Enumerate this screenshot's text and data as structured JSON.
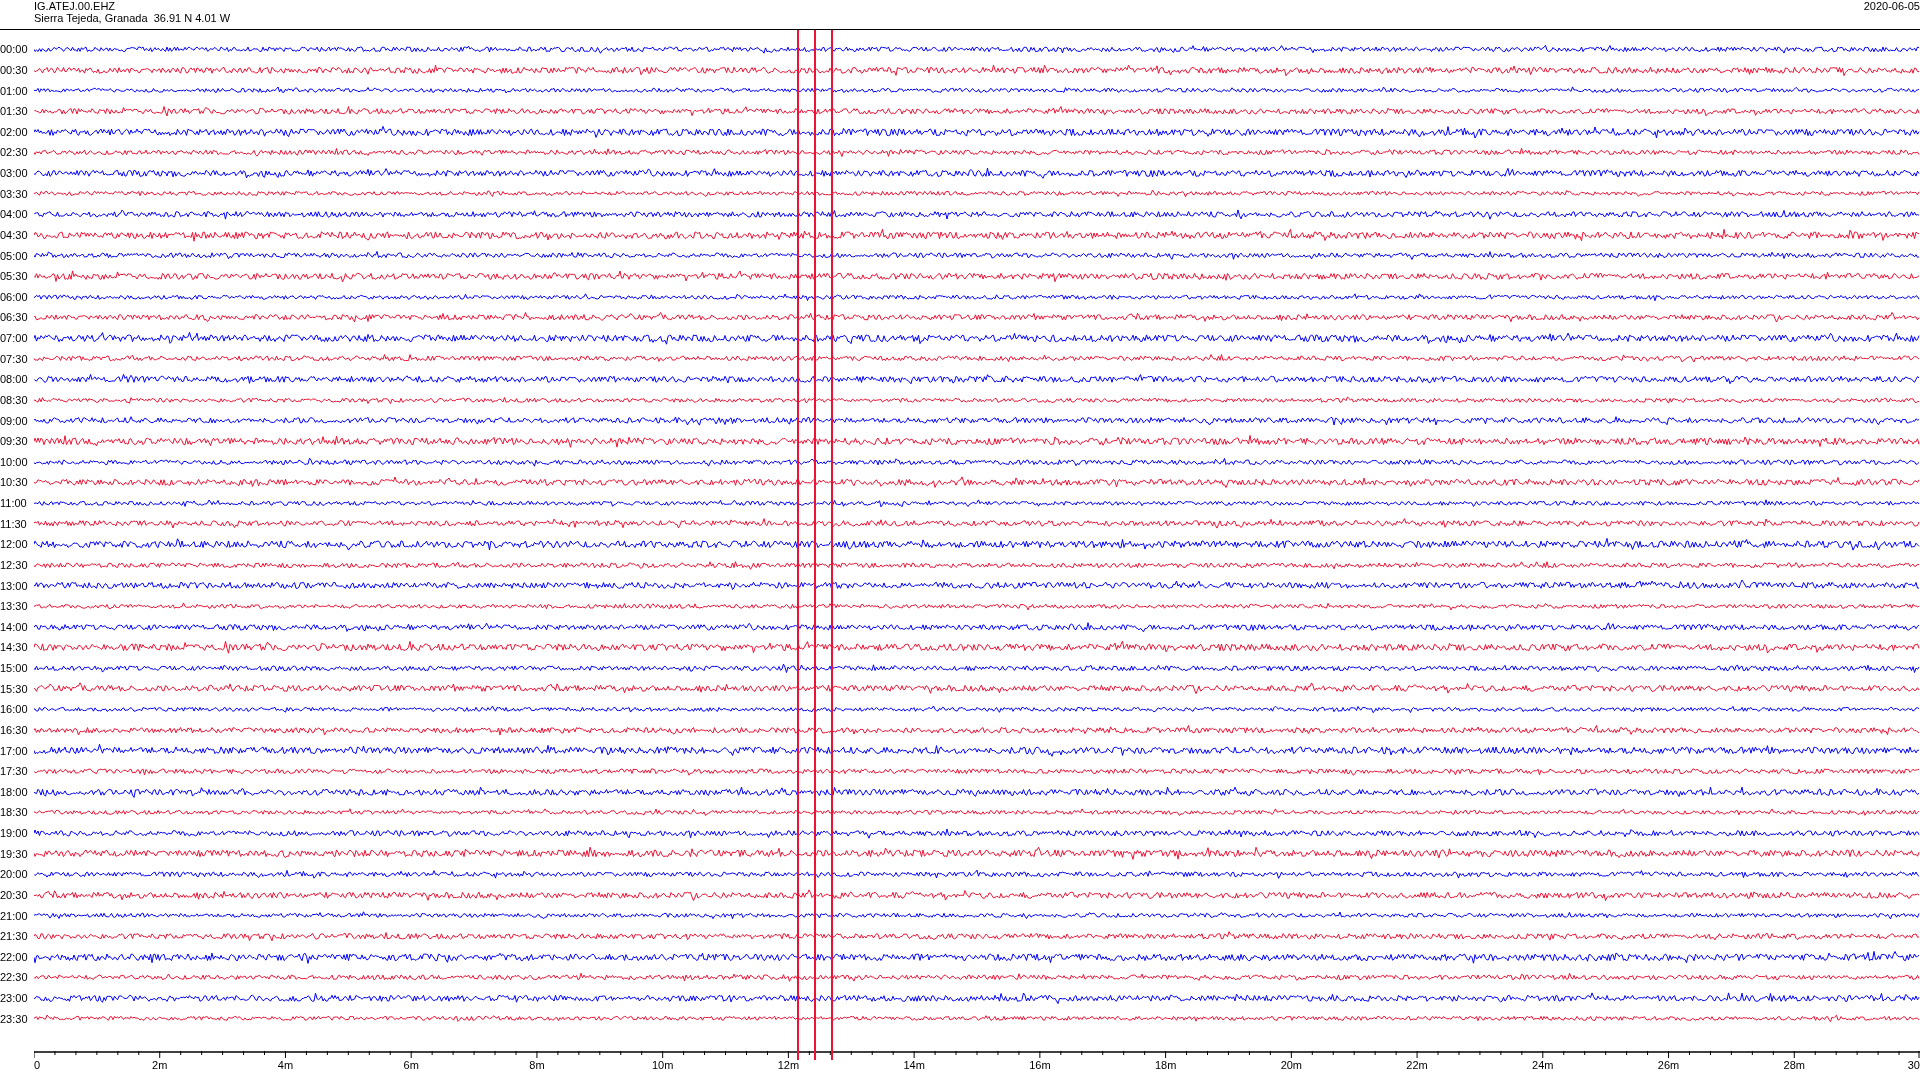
{
  "header": {
    "station": "IG.ATEJ.00.EHZ",
    "location": "Sierra Tejeda, Granada  36.91 N 4.01 W",
    "date": "2020-06-05"
  },
  "rows": [
    {
      "time": "00:00",
      "color": "#0000ff"
    },
    {
      "time": "00:30",
      "color": "#ee1133"
    },
    {
      "time": "01:00",
      "color": "#0000ff"
    },
    {
      "time": "01:30",
      "color": "#ee1133"
    },
    {
      "time": "02:00",
      "color": "#0000ff"
    },
    {
      "time": "02:30",
      "color": "#ee1133"
    },
    {
      "time": "03:00",
      "color": "#0000ff"
    },
    {
      "time": "03:30",
      "color": "#ee1133"
    },
    {
      "time": "04:00",
      "color": "#0000ff"
    },
    {
      "time": "04:30",
      "color": "#ee1133"
    },
    {
      "time": "05:00",
      "color": "#0000ff"
    },
    {
      "time": "05:30",
      "color": "#ee1133"
    },
    {
      "time": "06:00",
      "color": "#0000ff"
    },
    {
      "time": "06:30",
      "color": "#ee1133"
    },
    {
      "time": "07:00",
      "color": "#0000ff"
    },
    {
      "time": "07:30",
      "color": "#ee1133"
    },
    {
      "time": "08:00",
      "color": "#0000ff"
    },
    {
      "time": "08:30",
      "color": "#ee1133"
    },
    {
      "time": "09:00",
      "color": "#0000ff"
    },
    {
      "time": "09:30",
      "color": "#ee1133"
    },
    {
      "time": "10:00",
      "color": "#0000ff"
    },
    {
      "time": "10:30",
      "color": "#ee1133"
    },
    {
      "time": "11:00",
      "color": "#0000ff"
    },
    {
      "time": "11:30",
      "color": "#ee1133"
    },
    {
      "time": "12:00",
      "color": "#0000ff"
    },
    {
      "time": "12:30",
      "color": "#ee1133"
    },
    {
      "time": "13:00",
      "color": "#0000ff"
    },
    {
      "time": "13:30",
      "color": "#ee1133"
    },
    {
      "time": "14:00",
      "color": "#0000ff"
    },
    {
      "time": "14:30",
      "color": "#ee1133"
    },
    {
      "time": "15:00",
      "color": "#0000ff"
    },
    {
      "time": "15:30",
      "color": "#ee1133"
    },
    {
      "time": "16:00",
      "color": "#0000ff"
    },
    {
      "time": "16:30",
      "color": "#ee1133"
    },
    {
      "time": "17:00",
      "color": "#0000ff"
    },
    {
      "time": "17:30",
      "color": "#ee1133"
    },
    {
      "time": "18:00",
      "color": "#0000ff"
    },
    {
      "time": "18:30",
      "color": "#ee1133"
    },
    {
      "time": "19:00",
      "color": "#0000ff"
    },
    {
      "time": "19:30",
      "color": "#ee1133"
    },
    {
      "time": "20:00",
      "color": "#0000ff"
    },
    {
      "time": "20:30",
      "color": "#ee1133"
    },
    {
      "time": "21:00",
      "color": "#0000ff"
    },
    {
      "time": "21:30",
      "color": "#ee1133"
    },
    {
      "time": "22:00",
      "color": "#0000ff"
    },
    {
      "time": "22:30",
      "color": "#ee1133"
    },
    {
      "time": "23:00",
      "color": "#0000ff"
    },
    {
      "time": "23:30",
      "color": "#ee1133"
    }
  ],
  "x_axis": {
    "labels": [
      "0",
      "2m",
      "4m",
      "6m",
      "8m",
      "10m",
      "12m",
      "14m",
      "16m",
      "18m",
      "20m",
      "22m",
      "24m",
      "26m",
      "28m",
      "30"
    ]
  }
}
